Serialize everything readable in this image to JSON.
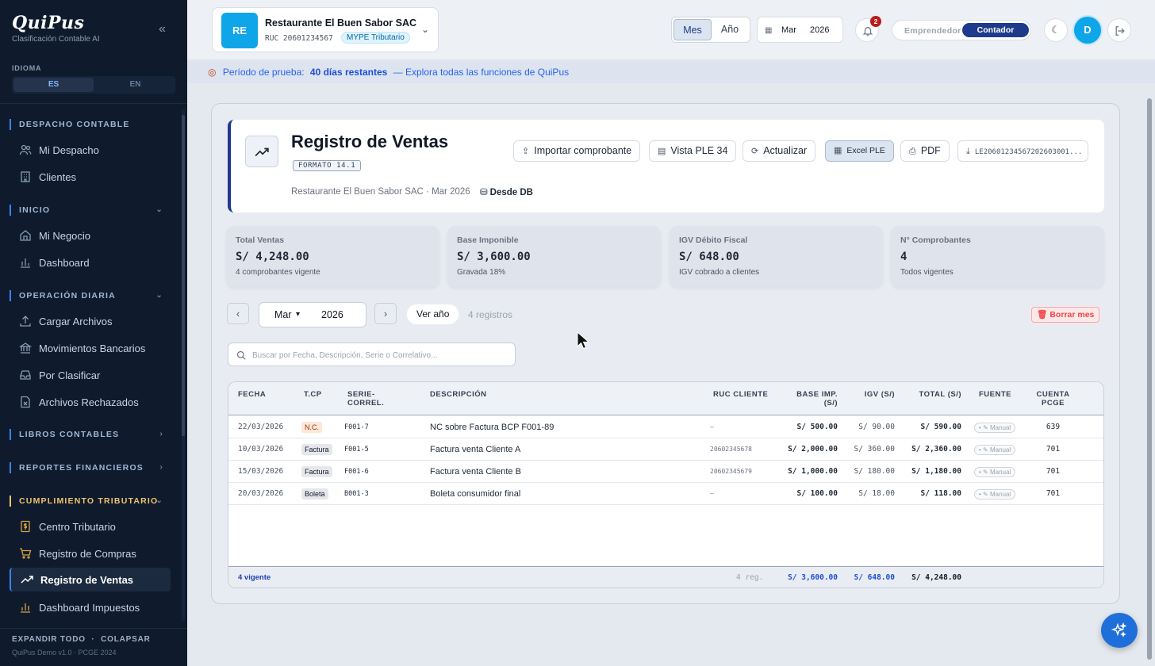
{
  "brand": {
    "name": "QuiPus",
    "tagline": "Clasificación Contable AI"
  },
  "language": {
    "label": "IDIOMA",
    "options": [
      "ES",
      "EN"
    ],
    "selected": "ES"
  },
  "sidebar": {
    "sections": [
      {
        "title": "DESPACHO CONTABLE",
        "items": [
          "Mi Despacho",
          "Clientes"
        ]
      },
      {
        "title": "INICIO",
        "items": [
          "Mi Negocio",
          "Dashboard"
        ]
      },
      {
        "title": "OPERACIÓN DIARIA",
        "items": [
          "Cargar Archivos",
          "Movimientos Bancarios",
          "Por Clasificar",
          "Archivos Rechazados"
        ]
      },
      {
        "title": "LIBROS CONTABLES",
        "items": []
      },
      {
        "title": "REPORTES FINANCIEROS",
        "items": []
      },
      {
        "title": "CUMPLIMIENTO TRIBUTARIO",
        "items": [
          "Centro Tributario",
          "Registro de Compras",
          "Registro de Ventas",
          "Dashboard Impuestos"
        ]
      }
    ],
    "active_item": "Registro de Ventas",
    "footer_expand": "EXPANDIR TODO",
    "footer_sep": "·",
    "footer_collapse": "COLAPSAR",
    "version": "QuiPus Demo v1.0 · PCGE 2024"
  },
  "topbar": {
    "company_initials": "RE",
    "company_name": "Restaurante El Buen Sabor SAC",
    "company_ruc": "RUC 20601234567",
    "company_regime": "MYPE Tributario",
    "period_options": [
      "Mes",
      "Año"
    ],
    "period_selected": "Mes",
    "month": "Mar",
    "year": "2026",
    "notifications": "2",
    "roles": [
      "Emprendedor",
      "Contador"
    ],
    "role_selected": "Contador",
    "user_initial": "D"
  },
  "trial": {
    "label": "Período de prueba:",
    "days": "40 días restantes",
    "message": "— Explora todas las funciones de QuiPus"
  },
  "page": {
    "title": "Registro de Ventas",
    "format_badge": "FORMATO 14.1",
    "subtitle": "Restaurante El Buen Sabor SAC · Mar 2026",
    "source": "Desde DB",
    "actions": {
      "import": "Importar comprobante",
      "ple_view": "Vista PLE 34",
      "refresh": "Actualizar",
      "excel": "Excel PLE",
      "pdf": "PDF",
      "file": "LE20601234567202603001..."
    }
  },
  "kpis": [
    {
      "label": "Total Ventas",
      "value": "S/ 4,248.00",
      "note": "4 comprobantes vigente"
    },
    {
      "label": "Base Imponible",
      "value": "S/ 3,600.00",
      "note": "Gravada 18%"
    },
    {
      "label": "IGV Débito Fiscal",
      "value": "S/ 648.00",
      "note": "IGV cobrado a clientes"
    },
    {
      "label": "N° Comprobantes",
      "value": "4",
      "note": "Todos vigentes"
    }
  ],
  "filters": {
    "month": "Mar",
    "year": "2026",
    "view_year": "Ver año",
    "records": "4 registros",
    "delete_month": "Borrar mes",
    "search_placeholder": "Buscar por Fecha, Descripción, Serie o Correlativo..."
  },
  "table": {
    "headers": {
      "fecha": "FECHA",
      "tcp": "T.CP",
      "serie_l1": "SERIE-",
      "serie_l2": "CORREL.",
      "desc": "DESCRIPCIÓN",
      "ruc": "RUC CLIENTE",
      "base_l1": "BASE IMP.",
      "base_l2": "(S/)",
      "igv": "IGV (S/)",
      "total": "TOTAL (S/)",
      "fuente": "FUENTE",
      "cuenta_l1": "CUENTA",
      "cuenta_l2": "PCGE"
    },
    "rows": [
      {
        "fecha": "22/03/2026",
        "tcp": "N.C.",
        "serie": "F001-7",
        "desc": "NC sobre Factura BCP F001-89",
        "ruc": "–",
        "base": "S/ 500.00",
        "igv": "S/ 90.00",
        "total": "S/ 590.00",
        "fuente": "• ✎ Manual",
        "cuenta": "639"
      },
      {
        "fecha": "10/03/2026",
        "tcp": "Factura",
        "serie": "F001-5",
        "desc": "Factura venta Cliente A",
        "ruc": "20602345678",
        "base": "S/ 2,000.00",
        "igv": "S/ 360.00",
        "total": "S/ 2,360.00",
        "fuente": "• ✎ Manual",
        "cuenta": "701"
      },
      {
        "fecha": "15/03/2026",
        "tcp": "Factura",
        "serie": "F001-6",
        "desc": "Factura venta Cliente B",
        "ruc": "20602345679",
        "base": "S/ 1,000.00",
        "igv": "S/ 180.00",
        "total": "S/ 1,180.00",
        "fuente": "• ✎ Manual",
        "cuenta": "701"
      },
      {
        "fecha": "20/03/2026",
        "tcp": "Boleta",
        "serie": "B001-3",
        "desc": "Boleta consumidor final",
        "ruc": "–",
        "base": "S/ 100.00",
        "igv": "S/ 18.00",
        "total": "S/ 118.00",
        "fuente": "• ✎ Manual",
        "cuenta": "701"
      }
    ],
    "footer": {
      "status": "4 vigente",
      "count": "4 reg.",
      "base": "S/ 3,600.00",
      "igv": "S/ 648.00",
      "total": "S/ 4,248.00"
    }
  },
  "colors": {
    "sidebar_bg": "#0f1b2d",
    "accent": "#1e3a8a",
    "brand_cyan": "#0ea5e9",
    "danger": "#ef4444"
  }
}
